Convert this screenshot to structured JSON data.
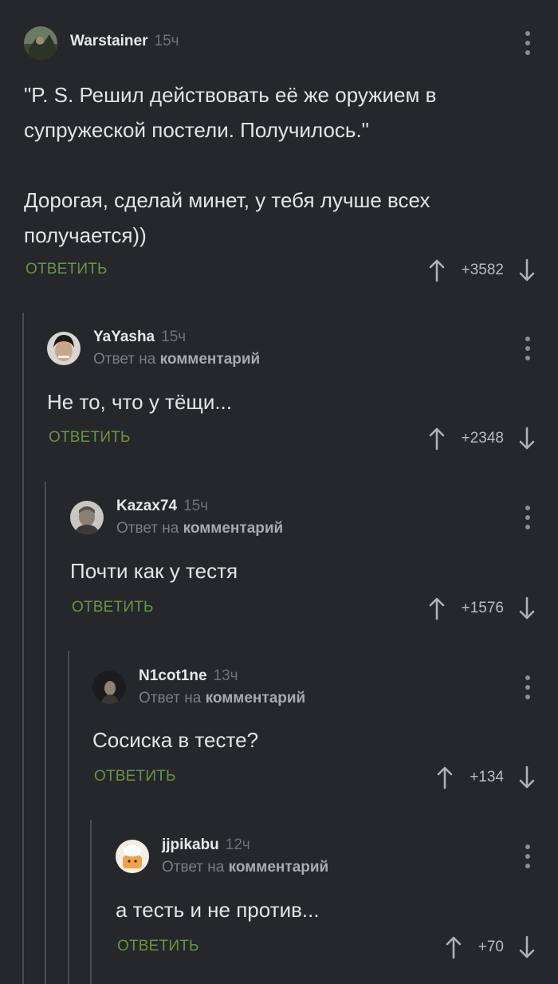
{
  "comments": [
    {
      "username": "Warstainer",
      "time": "15ч",
      "reply_prefix": "",
      "reply_target": "",
      "text": "\"P. S. Решил действовать её же оружием в супружеской постели. Получилось.\"\n\nДорогая, сделай минет, у тебя лучше всех получается))",
      "reply_label": "ОТВЕТИТЬ",
      "score": "+3582"
    },
    {
      "username": "YaYasha",
      "time": "15ч",
      "reply_prefix": "Ответ на",
      "reply_target": "комментарий",
      "text": "Не то, что у тёщи...",
      "reply_label": "ОТВЕТИТЬ",
      "score": "+2348"
    },
    {
      "username": "Kazax74",
      "time": "15ч",
      "reply_prefix": "Ответ на",
      "reply_target": "комментарий",
      "text": "Почти как у тестя",
      "reply_label": "ОТВЕТИТЬ",
      "score": "+1576"
    },
    {
      "username": "N1cot1ne",
      "time": "13ч",
      "reply_prefix": "Ответ на",
      "reply_target": "комментарий",
      "text": "Сосиска в тесте?",
      "reply_label": "ОТВЕТИТЬ",
      "score": "+134"
    },
    {
      "username": "jjpikabu",
      "time": "12ч",
      "reply_prefix": "Ответ на",
      "reply_target": "комментарий",
      "text": "а тесть и не против...",
      "reply_label": "ОТВЕТИТЬ",
      "score": "+70"
    }
  ],
  "colors": {
    "background": "#25272b",
    "reply_button": "#6b9248",
    "thread_line": "#4a4c50",
    "username": "#e8e8e8",
    "meta": "#7b7d81"
  },
  "icons": {
    "menu": "vertical-dots-icon",
    "upvote": "arrow-up-icon",
    "downvote": "arrow-down-icon"
  }
}
